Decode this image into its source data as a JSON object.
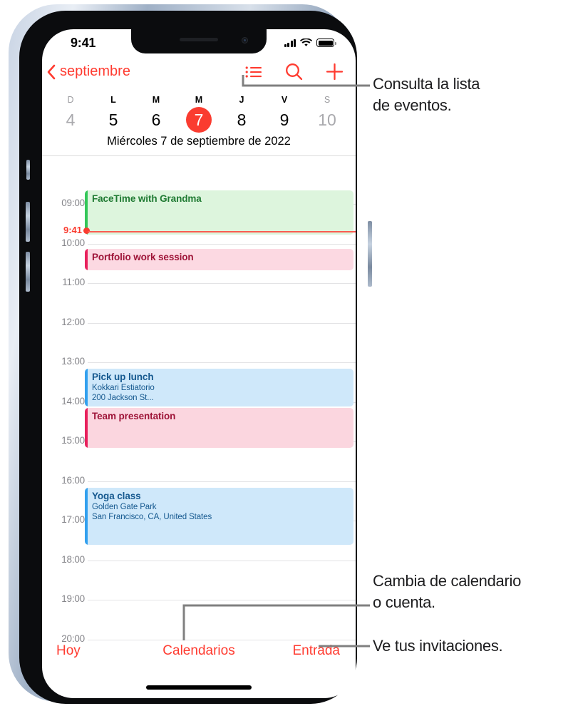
{
  "status_bar": {
    "time": "9:41",
    "cellular_icon": "signal-bars-icon",
    "wifi_icon": "wifi-icon",
    "battery_icon": "battery-icon"
  },
  "nav_bar": {
    "back_label": "septiembre",
    "back_icon": "chevron-left-icon",
    "actions": [
      {
        "name": "list-view-icon",
        "label": "Lista"
      },
      {
        "name": "search-icon",
        "label": "Buscar"
      },
      {
        "name": "plus-icon",
        "label": "Añadir"
      }
    ]
  },
  "week_strip": {
    "day_initials": [
      "D",
      "L",
      "M",
      "M",
      "J",
      "V",
      "S"
    ],
    "day_initials_muted": [
      true,
      false,
      false,
      false,
      false,
      false,
      true
    ],
    "dates": [
      "4",
      "5",
      "6",
      "7",
      "8",
      "9",
      "10"
    ],
    "dates_muted": [
      true,
      false,
      false,
      false,
      false,
      false,
      true
    ],
    "today_index": 3,
    "today_color": "#fa3c30",
    "date_line": "Miércoles  7 de septiembre de 2022"
  },
  "day_grid": {
    "hours": [
      "09:00",
      "10:00",
      "11:00",
      "12:00",
      "13:00",
      "14:00",
      "15:00",
      "16:00",
      "17:00",
      "18:00",
      "19:00",
      "20:00"
    ],
    "now": {
      "label": "9:41",
      "color": "#fa3c30"
    },
    "events": [
      {
        "title": "FaceTime with Grandma",
        "sub1": "",
        "sub2": "",
        "bar_color": "#34c759",
        "bg_color": "#ddf5dd",
        "text_color": "#1f7a32"
      },
      {
        "title": "Portfolio work session",
        "sub1": "",
        "sub2": "",
        "bar_color": "#e8205c",
        "bg_color": "#fcd9e2",
        "text_color": "#9e1438"
      },
      {
        "title": "Pick up lunch",
        "sub1": "Kokkari Estiatorio",
        "sub2": "200 Jackson St...",
        "bar_color": "#32a0ee",
        "bg_color": "#cfe8fa",
        "text_color": "#16598f"
      },
      {
        "title": "Team presentation",
        "sub1": "",
        "sub2": "",
        "bar_color": "#e8205c",
        "bg_color": "#fbd6df",
        "text_color": "#9e1438"
      },
      {
        "title": "Yoga class",
        "sub1": "Golden Gate Park",
        "sub2": "San Francisco, CA, United States",
        "bar_color": "#32a0ee",
        "bg_color": "#cfe8fa",
        "text_color": "#16598f"
      }
    ]
  },
  "toolbar": {
    "today_label": "Hoy",
    "calendars_label": "Calendarios",
    "inbox_label": "Entrada",
    "accent_color": "#ff3b30"
  },
  "callouts": [
    {
      "text": "Consulta la lista\nde eventos."
    },
    {
      "text": "Cambia de calendario\no cuenta."
    },
    {
      "text": "Ve tus invitaciones."
    }
  ]
}
